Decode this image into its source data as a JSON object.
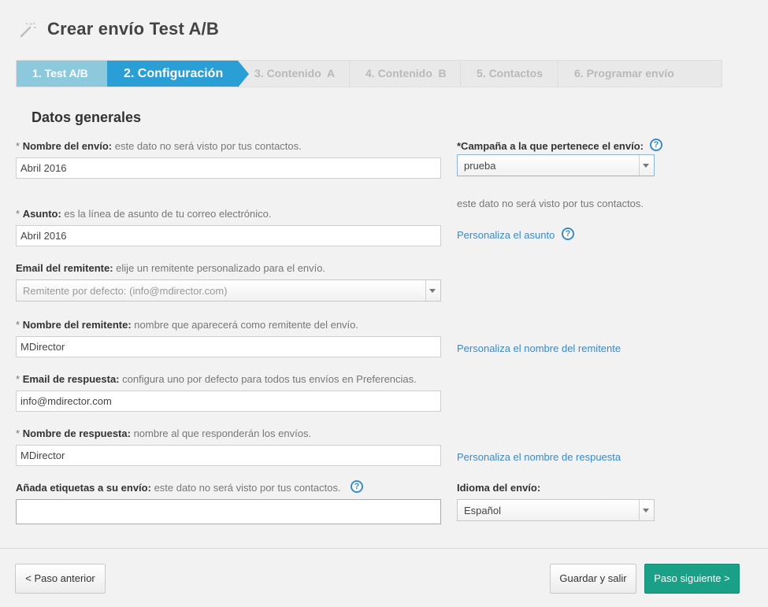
{
  "header": {
    "title": "Crear envío Test A/B",
    "icon": "magic-wand-icon"
  },
  "steps": [
    {
      "label": "1. Test A/B",
      "state": "done"
    },
    {
      "label": "2. Configuración",
      "state": "active"
    },
    {
      "label": "3. Contenido  A",
      "state": "pending"
    },
    {
      "label": "4. Contenido  B",
      "state": "pending"
    },
    {
      "label": "5. Contactos",
      "state": "pending"
    },
    {
      "label": "6. Programar envío",
      "state": "pending"
    }
  ],
  "section_title": "Datos generales",
  "form": {
    "nombre_envio": {
      "required": "*",
      "label": "Nombre del envío:",
      "hint": "este dato no será visto por tus contactos.",
      "value": "Abril 2016"
    },
    "asunto": {
      "required": "*",
      "label": "Asunto:",
      "hint": "es la línea de asunto de tu correo electrónico.",
      "value": "Abril 2016"
    },
    "email_remitente": {
      "label": "Email del remitente:",
      "hint": "elije un remitente personalizado para el envío.",
      "value": "Remitente por defecto: (info@mdirector.com)"
    },
    "nombre_remitente": {
      "required": "*",
      "label": "Nombre del remitente:",
      "hint": "nombre que aparecerá como remitente del envío.",
      "value": "MDirector"
    },
    "email_respuesta": {
      "required": "*",
      "label": "Email de respuesta:",
      "hint": "configura uno por defecto para todos tus envíos en Preferencias.",
      "value": "info@mdirector.com"
    },
    "nombre_respuesta": {
      "required": "*",
      "label": "Nombre de respuesta:",
      "hint": "nombre al que responderán los envíos.",
      "value": "MDirector"
    },
    "etiquetas": {
      "label": "Añada etiquetas a su envío:",
      "hint": "este dato no será visto por tus contactos.",
      "value": ""
    },
    "campana": {
      "label": "*Campaña a la que pertenece el envío:",
      "value": "prueba",
      "note": "este dato no será visto por tus contactos."
    },
    "idioma": {
      "label": "Idioma del envío:",
      "value": "Español"
    }
  },
  "links": {
    "personaliza_asunto": "Personaliza el asunto",
    "personaliza_remitente": "Personaliza el nombre del remitente",
    "personaliza_respuesta": "Personaliza el nombre de respuesta"
  },
  "help_glyph": "?",
  "footer": {
    "prev": "< Paso anterior",
    "save": "Guardar y salir",
    "next": "Paso siguiente >"
  },
  "colors": {
    "accent": "#2a9fd6",
    "done": "#8dc9dd",
    "primary_button": "#1aa087",
    "link": "#3b8ac4"
  }
}
